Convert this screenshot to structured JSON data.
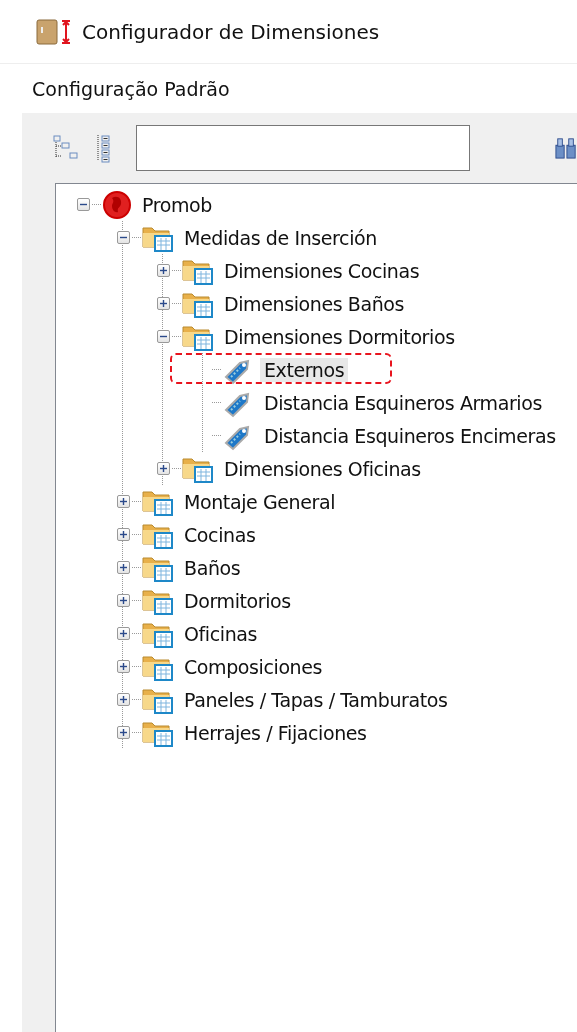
{
  "window": {
    "title": "Configurador de Dimensiones"
  },
  "section_title": "Configuração Padrão",
  "tree": [
    {
      "label": "Promob",
      "kind": "root",
      "expanded": true,
      "selected": false,
      "annotated": false,
      "children": [
        {
          "label": "Medidas de Inserción",
          "kind": "folder",
          "expanded": true,
          "selected": false,
          "annotated": false,
          "children": [
            {
              "label": "Dimensiones Cocinas",
              "kind": "folder",
              "expanded": false,
              "selected": false,
              "annotated": false
            },
            {
              "label": "Dimensiones Baños",
              "kind": "folder",
              "expanded": false,
              "selected": false,
              "annotated": false
            },
            {
              "label": "Dimensiones Dormitorios",
              "kind": "folder",
              "expanded": true,
              "selected": false,
              "annotated": false,
              "children": [
                {
                  "label": "Externos",
                  "kind": "leaf",
                  "selected": true,
                  "annotated": true
                },
                {
                  "label": "Distancia Esquineros Armarios",
                  "kind": "leaf",
                  "selected": false,
                  "annotated": false
                },
                {
                  "label": "Distancia Esquineros Encimeras",
                  "kind": "leaf",
                  "selected": false,
                  "annotated": false
                }
              ]
            },
            {
              "label": "Dimensiones Oficinas",
              "kind": "folder",
              "expanded": false,
              "selected": false,
              "annotated": false
            }
          ]
        },
        {
          "label": "Montaje General",
          "kind": "folder",
          "expanded": false,
          "selected": false,
          "annotated": false
        },
        {
          "label": "Cocinas",
          "kind": "folder",
          "expanded": false,
          "selected": false,
          "annotated": false
        },
        {
          "label": "Baños",
          "kind": "folder",
          "expanded": false,
          "selected": false,
          "annotated": false
        },
        {
          "label": "Dormitorios",
          "kind": "folder",
          "expanded": false,
          "selected": false,
          "annotated": false
        },
        {
          "label": "Oficinas",
          "kind": "folder",
          "expanded": false,
          "selected": false,
          "annotated": false
        },
        {
          "label": "Composiciones",
          "kind": "folder",
          "expanded": false,
          "selected": false,
          "annotated": false
        },
        {
          "label": "Paneles / Tapas / Tamburatos",
          "kind": "folder",
          "expanded": false,
          "selected": false,
          "annotated": false
        },
        {
          "label": "Herrajes / Fijaciones",
          "kind": "folder",
          "expanded": false,
          "selected": false,
          "annotated": false
        }
      ]
    }
  ]
}
